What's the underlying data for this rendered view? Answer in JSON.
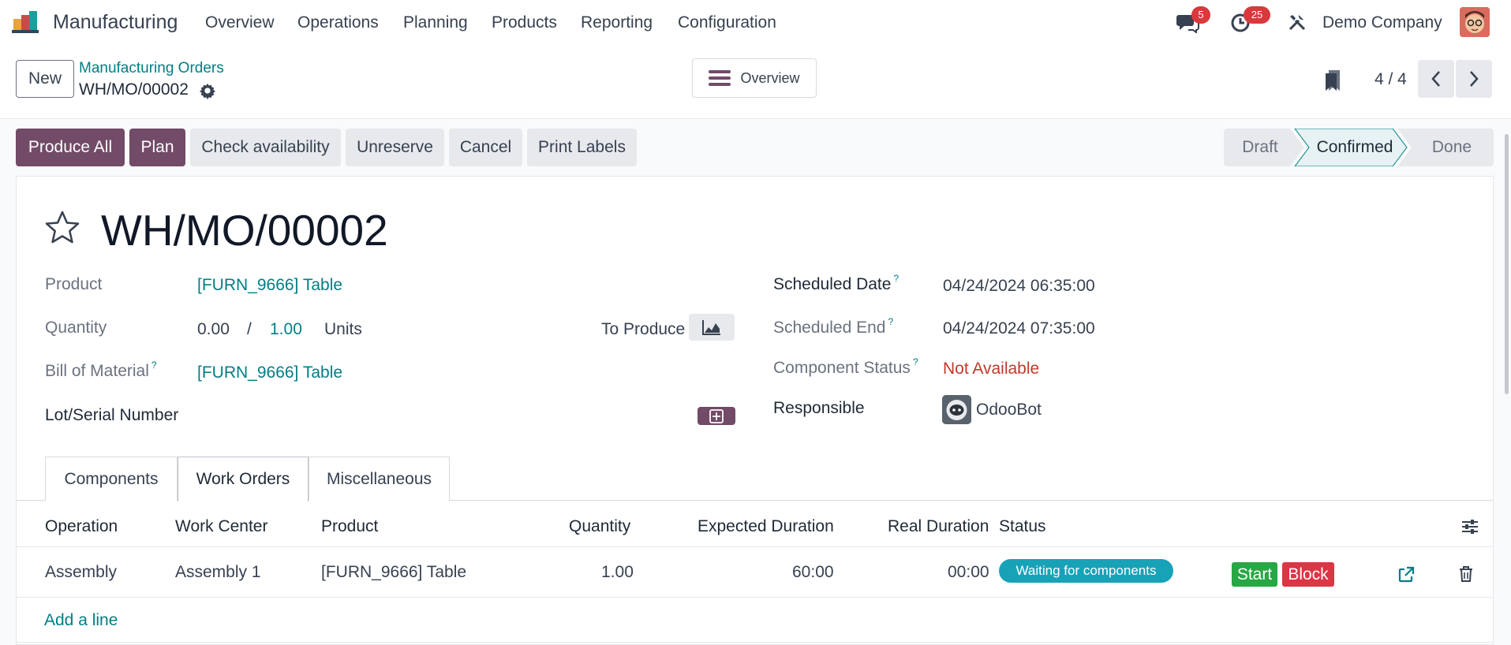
{
  "navbar": {
    "app_name": "Manufacturing",
    "menu": [
      "Overview",
      "Operations",
      "Planning",
      "Products",
      "Reporting",
      "Configuration"
    ],
    "messages_count": "5",
    "activities_count": "25",
    "company": "Demo Company"
  },
  "control_panel": {
    "new_label": "New",
    "breadcrumb_parent": "Manufacturing Orders",
    "breadcrumb_current": "WH/MO/00002",
    "overview_label": "Overview",
    "pager": "4 / 4"
  },
  "actions": {
    "produce_all": "Produce All",
    "plan": "Plan",
    "check_availability": "Check availability",
    "unreserve": "Unreserve",
    "cancel": "Cancel",
    "print_labels": "Print Labels"
  },
  "statusbar": {
    "stages": [
      "Draft",
      "Confirmed",
      "Done"
    ],
    "current": "Confirmed"
  },
  "form": {
    "title": "WH/MO/00002",
    "product_label": "Product",
    "product_value": "[FURN_9666] Table",
    "quantity_label": "Quantity",
    "quantity_produced": "0.00",
    "quantity_sep": "/",
    "quantity_total": "1.00",
    "quantity_uom": "Units",
    "to_produce_label": "To Produce",
    "bom_label": "Bill of Material",
    "bom_value": "[FURN_9666] Table",
    "lot_label": "Lot/Serial Number",
    "scheduled_date_label": "Scheduled Date",
    "scheduled_date_value": "04/24/2024 06:35:00",
    "scheduled_end_label": "Scheduled End",
    "scheduled_end_value": "04/24/2024 07:35:00",
    "component_status_label": "Component Status",
    "component_status_value": "Not Available",
    "responsible_label": "Responsible",
    "responsible_value": "OdooBot",
    "help_mark": "?"
  },
  "tabs": {
    "components": "Components",
    "work_orders": "Work Orders",
    "miscellaneous": "Miscellaneous"
  },
  "table": {
    "headers": {
      "operation": "Operation",
      "work_center": "Work Center",
      "product": "Product",
      "quantity": "Quantity",
      "expected_duration": "Expected Duration",
      "real_duration": "Real Duration",
      "status": "Status"
    },
    "rows": [
      {
        "operation": "Assembly",
        "work_center": "Assembly 1",
        "product": "[FURN_9666] Table",
        "quantity": "1.00",
        "expected_duration": "60:00",
        "real_duration": "00:00",
        "status": "Waiting for components",
        "start": "Start",
        "block": "Block"
      }
    ],
    "add_line": "Add a line"
  },
  "colors": {
    "brand": "#714b67",
    "link": "#017e84",
    "status_info": "#17a2b8",
    "success": "#28a745",
    "danger": "#dc3545"
  }
}
